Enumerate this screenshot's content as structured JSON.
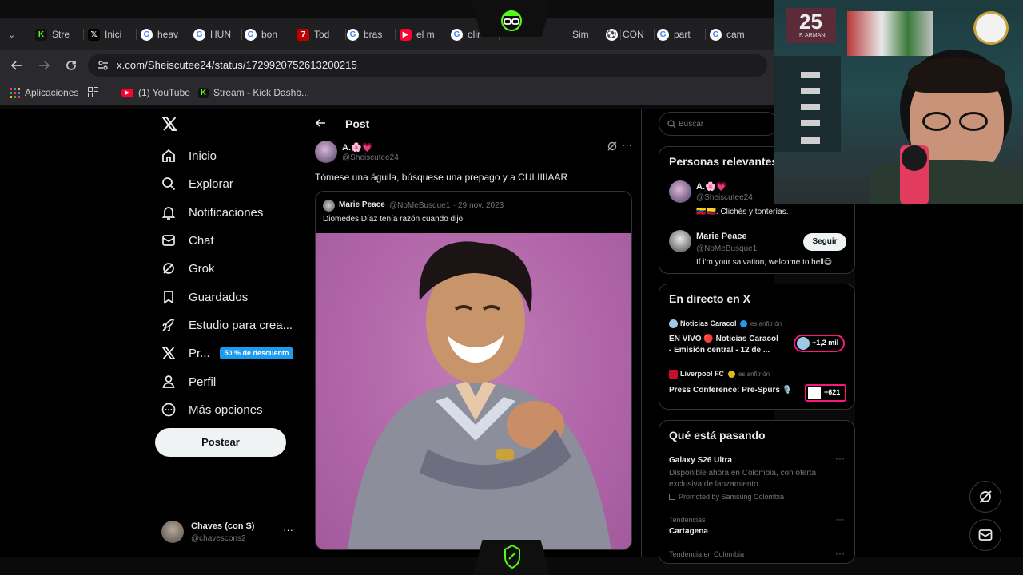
{
  "browser": {
    "tabs": [
      {
        "label": "Stre",
        "icon": "kick-icon"
      },
      {
        "label": "Inici",
        "icon": "x-icon"
      },
      {
        "label": "heav",
        "icon": "google-icon"
      },
      {
        "label": "HUN",
        "icon": "google-icon"
      },
      {
        "label": "bon",
        "icon": "google-icon"
      },
      {
        "label": "Tod",
        "icon": "red-icon"
      },
      {
        "label": "bras",
        "icon": "google-icon"
      },
      {
        "label": "el m",
        "icon": "youtube-icon"
      },
      {
        "label": "olir",
        "icon": "google-icon"
      },
      {
        "label": "Sim",
        "icon": "none"
      },
      {
        "label": "CON",
        "icon": "ball-icon"
      },
      {
        "label": "part",
        "icon": "google-icon"
      },
      {
        "label": "cam",
        "icon": "google-icon"
      }
    ],
    "url": "x.com/Sheiscutee24/status/1729920752613200215",
    "bookmarks": [
      {
        "label": "Aplicaciones",
        "icon": "apps-grid-icon"
      },
      {
        "label": "",
        "icon": "grid-icon"
      },
      {
        "label": "(1) YouTube",
        "icon": "youtube-icon"
      },
      {
        "label": "Stream - Kick Dashb...",
        "icon": "kick-icon"
      }
    ]
  },
  "sidebar": {
    "logo": "X",
    "items": [
      {
        "label": "Inicio",
        "icon": "home-icon"
      },
      {
        "label": "Explorar",
        "icon": "search-icon"
      },
      {
        "label": "Notificaciones",
        "icon": "bell-icon"
      },
      {
        "label": "Chat",
        "icon": "mail-icon"
      },
      {
        "label": "Grok",
        "icon": "grok-icon"
      },
      {
        "label": "Guardados",
        "icon": "bookmark-icon"
      },
      {
        "label": "Estudio para crea...",
        "icon": "rocket-icon"
      },
      {
        "label": "Pr...",
        "icon": "x-premium-icon"
      },
      {
        "label": "Perfil",
        "icon": "person-icon"
      },
      {
        "label": "Más opciones",
        "icon": "more-circle-icon"
      }
    ],
    "premium_badge": "50 % de descuento",
    "post_button": "Postear",
    "account": {
      "name": "Chaves (con S)",
      "handle": "@chavescons2"
    }
  },
  "post": {
    "header": "Post",
    "author_name": "A.🌸💗",
    "author_handle": "@Sheiscutee24",
    "text": "Tómese una águila, búsquese una prepago y a CULIIIIAAR",
    "quote": {
      "author_name": "Marie Peace",
      "author_handle": "@NoMeBusque1",
      "date": "· 29 nov. 2023",
      "text": "Diomedes Díaz tenía razón cuando dijo:"
    }
  },
  "right": {
    "search_placeholder": "Buscar",
    "relevant": {
      "title": "Personas relevantes",
      "people": [
        {
          "name": "A.🌸💗",
          "handle": "@Sheiscutee24",
          "bio": "🇻🇪🇨🇴. Clichés y tonterías."
        },
        {
          "name": "Marie Peace",
          "handle": "@NoMeBusque1",
          "bio": "If i'm your salvation, welcome to hell😉",
          "follow_label": "Seguir"
        }
      ]
    },
    "live": {
      "title": "En directo en X",
      "items": [
        {
          "host": "Noticias Caracol",
          "host_tag": "es anfitrión",
          "title_line1": "EN VIVO 🔴 Noticias Caracol",
          "title_line2": "- Emisión central - 12 de ...",
          "count": "+1,2 mil"
        },
        {
          "host": "Liverpool FC",
          "host_tag": "es anfitrión",
          "title_line1": "Press Conference: Pre-Spurs 🎙️",
          "count": "+621"
        }
      ]
    },
    "trends": {
      "title": "Qué está pasando",
      "items": [
        {
          "title": "Galaxy S26 Ultra",
          "desc1": "Disponible ahora en Colombia, con oferta",
          "desc2": "exclusiva de lanzamiento",
          "promo": "Promoted by Samsung Colombia"
        },
        {
          "category": "Tendencias",
          "title": "Cartagena"
        },
        {
          "category": "Tendencia en Colombia"
        }
      ]
    }
  },
  "webcam": {
    "jersey_number": "25",
    "jersey_name": "F. ARMANI"
  }
}
